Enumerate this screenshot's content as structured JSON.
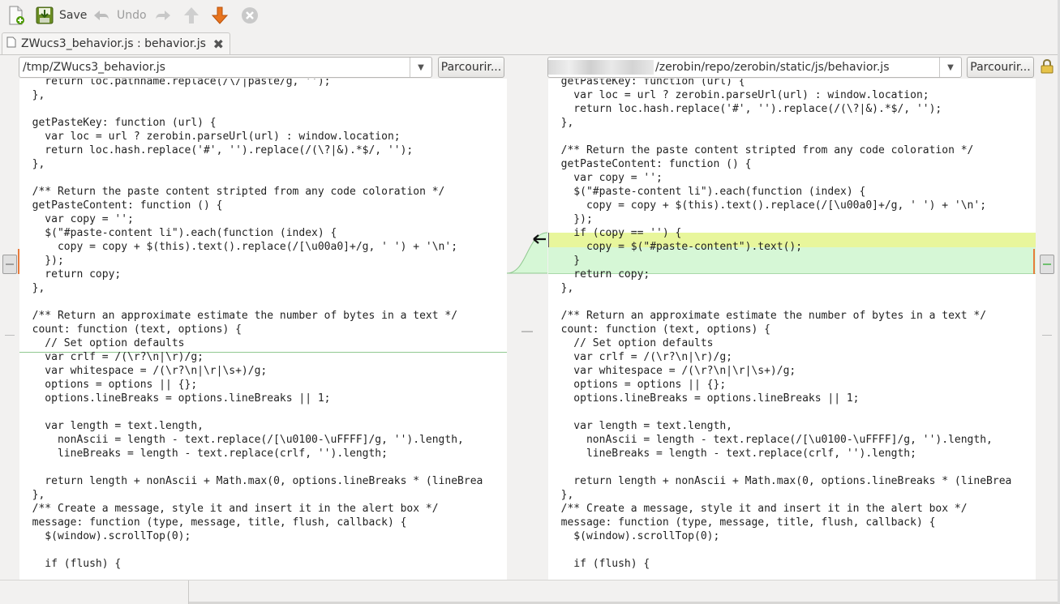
{
  "toolbar": {
    "new_icon": "new-file-icon",
    "save_label": "Save",
    "undo_label": "Undo",
    "redo_icon": "redo-icon",
    "prev_change_icon": "arrow-up-icon",
    "next_change_icon": "arrow-down-icon",
    "stop_icon": "stop-icon"
  },
  "tab": {
    "title": "ZWucs3_behavior.js : behavior.js"
  },
  "left": {
    "path": "/tmp/ZWucs3_behavior.js",
    "browse_label": "Parcourir..."
  },
  "right": {
    "path": "/zerobin/repo/zerobin/static/js/behavior.js",
    "browse_label": "Parcourir..."
  },
  "colors": {
    "changed": "#e8f69c",
    "inserted": "#d6f7d6",
    "marker": "#e77b3c"
  },
  "left_code": [
    "    return loc.pathname.replace(/\\/|paste/g, '');",
    "  },",
    "",
    "  getPasteKey: function (url) {",
    "    var loc = url ? zerobin.parseUrl(url) : window.location;",
    "    return loc.hash.replace('#', '').replace(/(\\?|&).*$/, '');",
    "  },",
    "",
    "  /** Return the paste content stripted from any code coloration */",
    "  getPasteContent: function () {",
    "    var copy = '';",
    "    $(\"#paste-content li\").each(function (index) {",
    "      copy = copy + $(this).text().replace(/[\\u00a0]+/g, ' ') + '\\n';",
    "    });",
    "    return copy;",
    "  },",
    "",
    "  /** Return an approximate estimate the number of bytes in a text */",
    "  count: function (text, options) {",
    "    // Set option defaults",
    "    var crlf = /(\\r?\\n|\\r)/g;",
    "    var whitespace = /(\\r?\\n|\\r|\\s+)/g;",
    "    options = options || {};",
    "    options.lineBreaks = options.lineBreaks || 1;",
    "",
    "    var length = text.length,",
    "      nonAscii = length - text.replace(/[\\u0100-\\uFFFF]/g, '').length,",
    "      lineBreaks = length - text.replace(crlf, '').length;",
    "",
    "    return length + nonAscii + Math.max(0, options.lineBreaks * (lineBrea",
    "  },",
    "  /** Create a message, style it and insert it in the alert box */",
    "  message: function (type, message, title, flush, callback) {",
    "    $(window).scrollTop(0);",
    "",
    "    if (flush) {"
  ],
  "right_code": [
    "  getPasteKey: function (url) {",
    "    var loc = url ? zerobin.parseUrl(url) : window.location;",
    "    return loc.hash.replace('#', '').replace(/(\\?|&).*$/, '');",
    "  },",
    "",
    "  /** Return the paste content stripted from any code coloration */",
    "  getPasteContent: function () {",
    "    var copy = '';",
    "    $(\"#paste-content li\").each(function (index) {",
    "      copy = copy + $(this).text().replace(/[\\u00a0]+/g, ' ') + '\\n';",
    "    });",
    "    if (copy == '') {",
    "      copy = $(\"#paste-content\").text();",
    "    }",
    "    return copy;",
    "  },",
    "",
    "  /** Return an approximate estimate the number of bytes in a text */",
    "  count: function (text, options) {",
    "    // Set option defaults",
    "    var crlf = /(\\r?\\n|\\r)/g;",
    "    var whitespace = /(\\r?\\n|\\r|\\s+)/g;",
    "    options = options || {};",
    "    options.lineBreaks = options.lineBreaks || 1;",
    "",
    "    var length = text.length,",
    "      nonAscii = length - text.replace(/[\\u0100-\\uFFFF]/g, '').length,",
    "      lineBreaks = length - text.replace(crlf, '').length;",
    "",
    "    return length + nonAscii + Math.max(0, options.lineBreaks * (lineBrea",
    "  },",
    "  /** Create a message, style it and insert it in the alert box */",
    "  message: function (type, message, title, flush, callback) {",
    "    $(window).scrollTop(0);",
    "",
    "    if (flush) {"
  ]
}
